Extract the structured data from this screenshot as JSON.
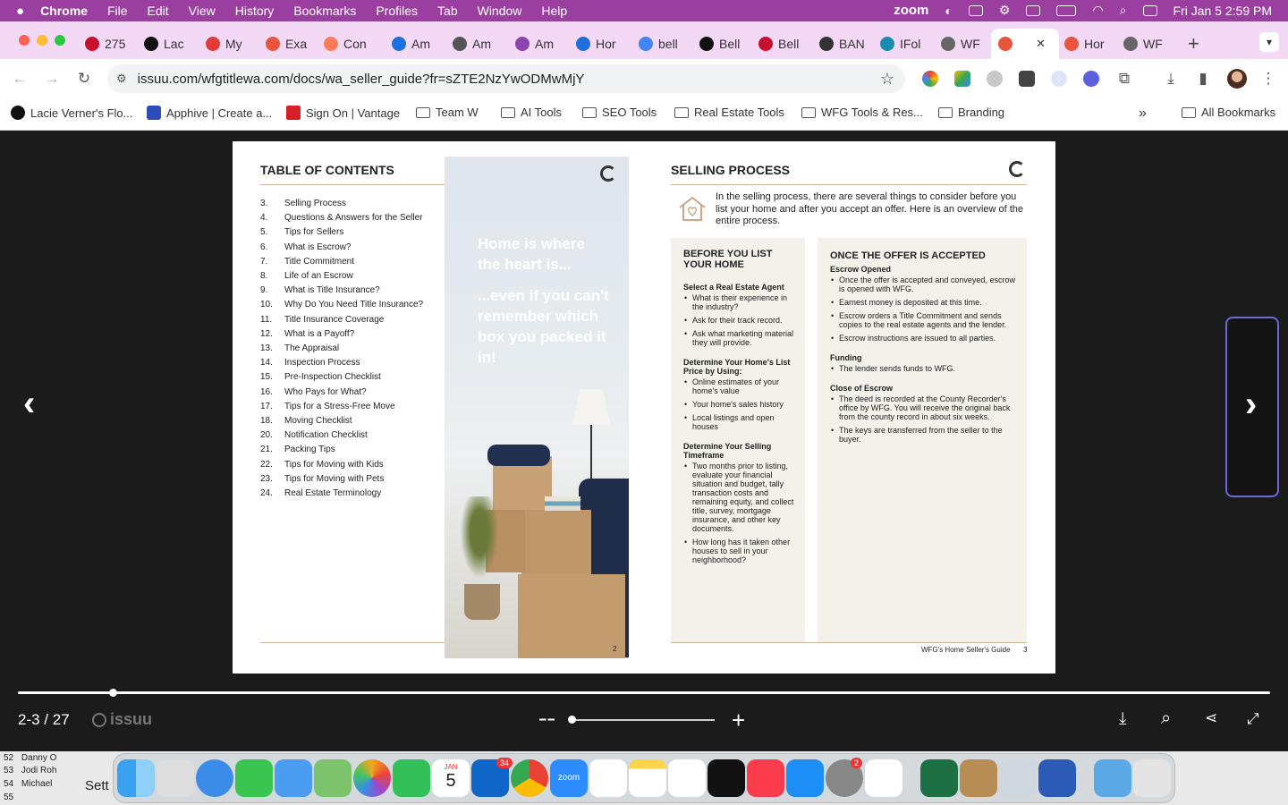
{
  "menubar": {
    "app": "Chrome",
    "items": [
      "File",
      "Edit",
      "View",
      "History",
      "Bookmarks",
      "Profiles",
      "Tab",
      "Window",
      "Help"
    ],
    "zoom_label": "zoom",
    "datetime": "Fri Jan 5  2:59 PM"
  },
  "tabs": [
    {
      "label": "275",
      "color": "#c8102e"
    },
    {
      "label": "Lac",
      "color": "#111"
    },
    {
      "label": "My",
      "color": "#e03a3a"
    },
    {
      "label": "Exa",
      "color": "#e8543e"
    },
    {
      "label": "Con",
      "color": "#ff7a59"
    },
    {
      "label": "Am",
      "color": "#1e6fd9"
    },
    {
      "label": "Am",
      "color": "#555"
    },
    {
      "label": "Am",
      "color": "#8b44ac"
    },
    {
      "label": "Hor",
      "color": "#1e6fd9"
    },
    {
      "label": "bell",
      "color": "#4285f4"
    },
    {
      "label": "Bell",
      "color": "#111"
    },
    {
      "label": "Bell",
      "color": "#c8102e"
    },
    {
      "label": "BAN",
      "color": "#333"
    },
    {
      "label": "IFol",
      "color": "#1a8cb0"
    },
    {
      "label": "WF",
      "color": "#666"
    },
    {
      "label": "",
      "color": "#e8543e"
    },
    {
      "label": "Hor",
      "color": "#e8543e"
    },
    {
      "label": "WF",
      "color": "#666"
    }
  ],
  "toolbar": {
    "url": "issuu.com/wfgtitlewa.com/docs/wa_seller_guide?fr=sZTE2NzYwODMwMjY"
  },
  "bookmarks": {
    "items": [
      "Lacie Verner's Flo...",
      "Apphive | Create a...",
      "Sign On | Vantage",
      "Team W",
      "AI Tools",
      "SEO Tools",
      "Real Estate Tools",
      "WFG Tools & Res...",
      "Branding"
    ],
    "more": "»",
    "all": "All Bookmarks"
  },
  "left_page": {
    "title": "TABLE OF CONTENTS",
    "toc": [
      {
        "num": "3.",
        "label": "Selling Process"
      },
      {
        "num": "4.",
        "label": "Questions & Answers for the Seller"
      },
      {
        "num": "5.",
        "label": "Tips for Sellers"
      },
      {
        "num": "6.",
        "label": "What is Escrow?"
      },
      {
        "num": "7.",
        "label": "Title Commitment"
      },
      {
        "num": "8.",
        "label": "Life of an Escrow"
      },
      {
        "num": "9.",
        "label": "What is Title Insurance?"
      },
      {
        "num": "10.",
        "label": "Why Do You Need Title Insurance?"
      },
      {
        "num": "11.",
        "label": "Title Insurance Coverage"
      },
      {
        "num": "12.",
        "label": "What is a Payoff?"
      },
      {
        "num": "13.",
        "label": "The Appraisal"
      },
      {
        "num": "14.",
        "label": "Inspection Process"
      },
      {
        "num": "15.",
        "label": "Pre-Inspection Checklist"
      },
      {
        "num": "16.",
        "label": "Who Pays for What?"
      },
      {
        "num": "17.",
        "label": "Tips for a Stress-Free Move"
      },
      {
        "num": "18.",
        "label": "Moving Checklist"
      },
      {
        "num": "20.",
        "label": "Notification Checklist"
      },
      {
        "num": "21.",
        "label": "Packing Tips"
      },
      {
        "num": "22.",
        "label": "Tips for Moving with Kids"
      },
      {
        "num": "23.",
        "label": "Tips for Moving with Pets"
      },
      {
        "num": "24.",
        "label": "Real Estate Terminology"
      }
    ],
    "photo_text_1": "Home is where the heart is...",
    "photo_text_2": "...even if you can't remember which box you packed it in!",
    "page_number": "2",
    "logo_text": "WFG"
  },
  "right_page": {
    "title": "SELLING PROCESS",
    "intro": "In the selling process, there are several things to consider before you list your home and after you accept an offer. Here is an overview of the entire process.",
    "before": {
      "heading": "BEFORE YOU LIST YOUR HOME",
      "sections": [
        {
          "title": "Select a Real Estate Agent",
          "items": [
            "What is their experience in the industry?",
            "Ask for their track record.",
            "Ask what marketing material they will provide."
          ]
        },
        {
          "title": "Determine Your Home's List Price by Using:",
          "items": [
            "Online estimates of your home's value",
            "Your home's sales history",
            "Local listings and open houses"
          ]
        },
        {
          "title": "Determine Your Selling Timeframe",
          "items": [
            "Two months prior to listing, evaluate your financial situation and budget, tally transaction costs and remaining equity, and collect title, survey, mortgage insurance, and other key documents.",
            "How long has it taken other houses to sell in your neighborhood?"
          ]
        }
      ]
    },
    "after": {
      "heading": "ONCE THE OFFER IS ACCEPTED",
      "sections": [
        {
          "title": "Escrow Opened",
          "items": [
            "Once the offer is accepted and conveyed, escrow is opened with WFG.",
            "Earnest money is deposited at this time.",
            "Escrow orders a Title Commitment and sends copies to the real estate agents and the lender.",
            "Escrow instructions are issued to all parties."
          ]
        },
        {
          "title": "Funding",
          "items": [
            "The lender sends funds to WFG."
          ]
        },
        {
          "title": "Close of Escrow",
          "items": [
            "The deed is recorded at the County Recorder's office by WFG. You will receive the original back from the county record in about six weeks.",
            "The keys are transferred from the seller to the buyer."
          ]
        }
      ]
    },
    "footer": "WFG's Home Seller's Guide",
    "page_number": "3"
  },
  "viewer": {
    "page_indicator": "2-3 / 27",
    "brand": "issuu",
    "reading_progress": 0.076,
    "zoom_level": 0.0
  },
  "dock": {
    "calendar_month": "JAN",
    "calendar_day": "5",
    "outlook_badge": "34",
    "settings_badge": "2",
    "zoom_label": "zoom"
  },
  "background_sheet": {
    "rows": [
      {
        "num": "52",
        "name": "Danny O"
      },
      {
        "num": "53",
        "name": "Jodi Roh"
      },
      {
        "num": "54",
        "name": "Michael"
      },
      {
        "num": "55",
        "name": ""
      }
    ],
    "label": "Sett"
  }
}
